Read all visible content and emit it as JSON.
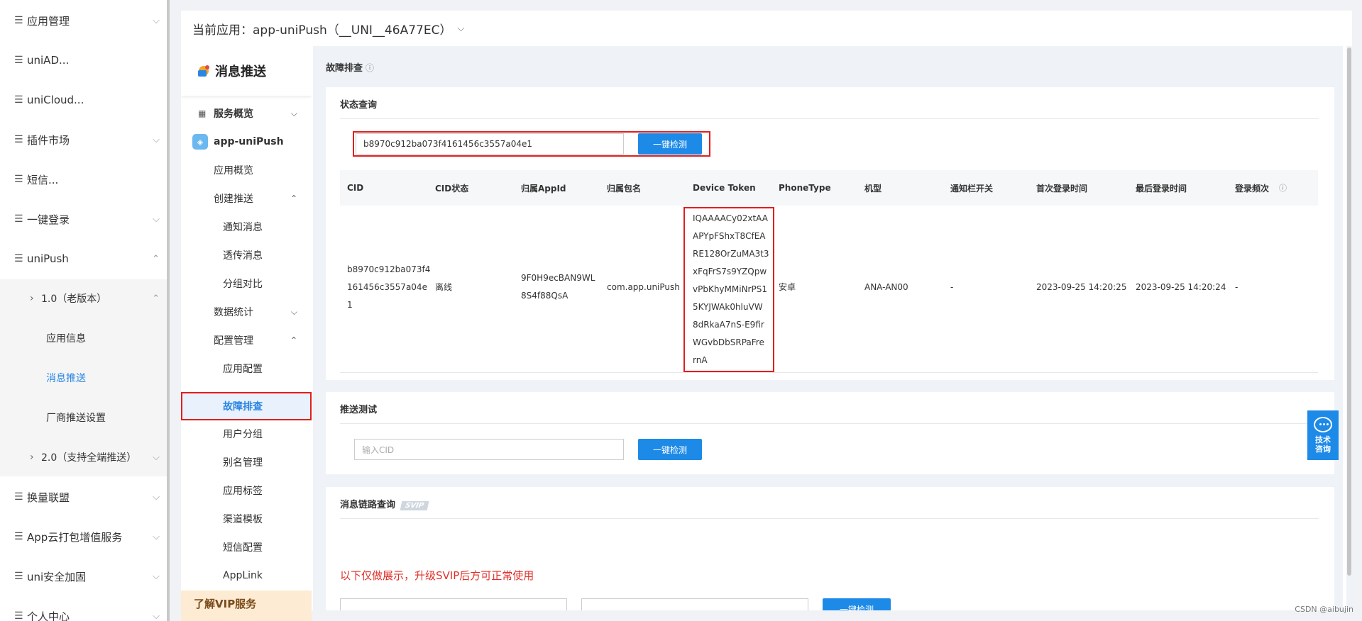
{
  "leftnav": {
    "items": [
      {
        "label": "应用管理",
        "chevron": "⌵"
      },
      {
        "label": "uniAD...",
        "chevron": ""
      },
      {
        "label": "uniCloud...",
        "chevron": ""
      },
      {
        "label": "插件市场",
        "chevron": "⌵"
      },
      {
        "label": "短信...",
        "chevron": ""
      },
      {
        "label": "一键登录",
        "chevron": "⌵"
      },
      {
        "label": "uniPush",
        "chevron": "⌃"
      }
    ],
    "uniPush_children": [
      {
        "label": "1.0（老版本）",
        "chevron": "⌃"
      },
      {
        "label": "应用信息"
      },
      {
        "label": "消息推送"
      },
      {
        "label": "厂商推送设置"
      },
      {
        "label": "2.0（支持全端推送）",
        "chevron": "⌵"
      }
    ],
    "items_after": [
      {
        "label": "换量联盟",
        "chevron": "⌵"
      },
      {
        "label": "App云打包增值服务",
        "chevron": "⌵"
      },
      {
        "label": "uni安全加固",
        "chevron": "⌵"
      },
      {
        "label": "个人中心",
        "chevron": "⌵"
      }
    ]
  },
  "topbar": {
    "current_app": "当前应用：app-uniPush（__UNI__46A77EC）",
    "dropdown_icon": "⌵"
  },
  "subnav": {
    "title": "消息推送",
    "overview": "服务概览",
    "app_name": "app-uniPush",
    "items": [
      {
        "label": "应用概览"
      },
      {
        "label": "创建推送",
        "chevron": "⌃"
      },
      {
        "label": "通知消息"
      },
      {
        "label": "透传消息"
      },
      {
        "label": "分组对比"
      },
      {
        "label": "数据统计",
        "chevron": "⌵"
      },
      {
        "label": "配置管理",
        "chevron": "⌃"
      },
      {
        "label": "应用配置"
      },
      {
        "label": "故障排查"
      },
      {
        "label": "用户分组"
      },
      {
        "label": "别名管理"
      },
      {
        "label": "应用标签"
      },
      {
        "label": "渠道模板"
      },
      {
        "label": "短信配置"
      },
      {
        "label": "AppLink"
      }
    ],
    "vip_label": "了解VIP服务"
  },
  "content": {
    "page_title": "故障排查",
    "help_icon": "?",
    "status_panel": {
      "title": "状态查询",
      "cid_value": "b8970c912ba073f4161456c3557a04e1",
      "button": "一键检测",
      "columns": [
        "CID",
        "CID状态",
        "归属AppId",
        "归属包名",
        "Device Token",
        "PhoneType",
        "机型",
        "通知栏开关",
        "首次登录时间",
        "最后登录时间",
        "登录频次"
      ],
      "row": {
        "cid_lines": [
          "b8970c912ba073f4",
          "161456c3557a04e",
          "1"
        ],
        "status": "离线",
        "appid_lines": [
          "9F0H9ecBAN9WL",
          "8S4f88QsA"
        ],
        "package": "com.app.uniPush",
        "token_lines": [
          "IQAAAACy02xtAA",
          "APYpFShxT8CfEA",
          "RE128OrZuMA3t3",
          "xFqFrS7s9YZQpw",
          "vPbKhyMMiNrPS1",
          "5KYJWAk0hluVW",
          "8dRkaA7nS-E9fir",
          "WGvbDbSRPaFre",
          "rnA"
        ],
        "phone_type": "安卓",
        "model": "ANA-AN00",
        "notify_switch": "-",
        "first_login": "2023-09-25 14:20:25",
        "last_login": "2023-09-25 14:20:24",
        "login_freq": "-"
      }
    },
    "push_test_panel": {
      "title": "推送测试",
      "cid_placeholder": "输入CID",
      "button": "一键检测"
    },
    "trace_panel": {
      "title": "消息链路查询",
      "badge": "SVIP",
      "notice": "以下仅做展示，升级SVIP后方可正常使用",
      "button": "一键检测"
    }
  },
  "float_help": {
    "line1": "技术",
    "line2": "咨询"
  },
  "watermark": "CSDN @aibujin",
  "colors": {
    "accent": "#1d8ae8",
    "highlight_border": "#e21d1d",
    "notice": "#e0302a"
  }
}
